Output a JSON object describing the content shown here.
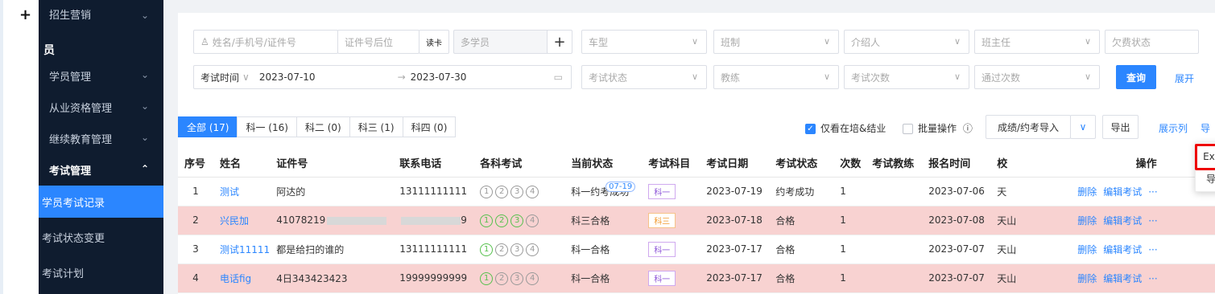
{
  "sidebar": {
    "items": [
      {
        "label": "招生营销",
        "chev": "⌄"
      },
      {
        "label": "员"
      },
      {
        "label": "学员管理",
        "chev": "⌄"
      },
      {
        "label": "从业资格管理",
        "chev": "⌄"
      },
      {
        "label": "继续教育管理",
        "chev": "⌄"
      },
      {
        "label": "考试管理",
        "chev": "⌃"
      },
      {
        "label": "学员考试记录"
      },
      {
        "label": "考试状态变更"
      },
      {
        "label": "考试计划"
      }
    ]
  },
  "filters": {
    "name_placeholder": "姓名/手机号/证件号",
    "id_suffix": "证件号后位",
    "read_card": "读卡",
    "multi_student": "多学员",
    "add": "+",
    "car_type": "车型",
    "class_type": "班制",
    "referrer": "介绍人",
    "teacher": "班主任",
    "fee_status": "欠费状态",
    "exam_time_label": "考试时间",
    "start_date": "2023-07-10",
    "range_sep": "→",
    "end_date": "2023-07-30",
    "exam_state": "考试状态",
    "coach": "教练",
    "exam_times": "考试次数",
    "pass_times": "通过次数",
    "search": "查询",
    "expand": "展开"
  },
  "tabs": [
    "全部 (17)",
    "科一 (16)",
    "科二 (0)",
    "科三 (1)",
    "科四 (0)"
  ],
  "toolbar": {
    "only_training": "仅看在培&结业",
    "batch": "批量操作",
    "info_icon": "ⓘ",
    "import": "成绩/约考导入",
    "export": "导出",
    "show_cols": "展示列",
    "more": "导"
  },
  "popup": {
    "excel": "Excel导入",
    "records": "导入记录"
  },
  "columns": [
    "序号",
    "姓名",
    "证件号",
    "联系电话",
    "各科考试",
    "当前状态",
    "考试科目",
    "考试日期",
    "考试状态",
    "次数",
    "考试教练",
    "报名时间",
    "校",
    "操作"
  ],
  "rows": [
    {
      "idx": "1",
      "name": "测试",
      "id": "阿达的",
      "phone": "13111111111",
      "state": "科一约考成功",
      "badge": "07-19",
      "subject": "科一",
      "date": "2023-07-19",
      "exam_state": "约考成功",
      "count": "1",
      "coach": "",
      "reg": "2023-07-06",
      "campus": "天",
      "pink": false,
      "greens": []
    },
    {
      "idx": "2",
      "name": "兴民加",
      "id": "41078219",
      "phone": "9",
      "state": "科三合格",
      "badge": "",
      "subject": "科三",
      "date": "2023-07-18",
      "exam_state": "合格",
      "count": "1",
      "coach": "",
      "reg": "2023-07-08",
      "campus": "天山",
      "pink": true,
      "greens": [
        1,
        2,
        3
      ]
    },
    {
      "idx": "3",
      "name": "测试11111",
      "id": "都是给扫的谁的",
      "phone": "13111111111",
      "state": "科一合格",
      "badge": "",
      "subject": "科一",
      "date": "2023-07-17",
      "exam_state": "合格",
      "count": "1",
      "coach": "",
      "reg": "2023-07-07",
      "campus": "天山",
      "pink": false,
      "greens": [
        1
      ]
    },
    {
      "idx": "4",
      "name": "电话fig",
      "id": "4日343423423",
      "phone": "19999999999",
      "state": "科一合格",
      "badge": "",
      "subject": "科一",
      "date": "2023-07-17",
      "exam_state": "合格",
      "count": "1",
      "coach": "",
      "reg": "2023-07-07",
      "campus": "天山",
      "pink": true,
      "greens": [
        1
      ]
    }
  ],
  "ops": {
    "delete": "删除",
    "edit": "编辑考试",
    "more": "···"
  }
}
